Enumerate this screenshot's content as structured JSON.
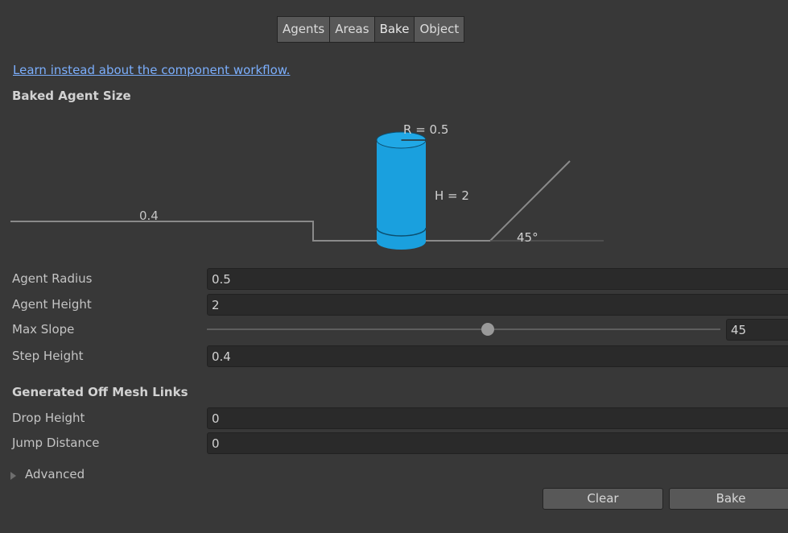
{
  "tabs": [
    "Agents",
    "Areas",
    "Bake",
    "Object"
  ],
  "active_tab": "Bake",
  "link_text": "Learn instead about the component workflow.",
  "section_baked": "Baked Agent Size",
  "diagram": {
    "radius_label": "R = 0.5",
    "height_label": "H = 2",
    "step_label": "0.4",
    "slope_label": "45°",
    "agent_color": "#1aa0de"
  },
  "fields": {
    "agent_radius": {
      "label": "Agent Radius",
      "value": "0.5"
    },
    "agent_height": {
      "label": "Agent Height",
      "value": "2"
    },
    "max_slope": {
      "label": "Max Slope",
      "value": "45",
      "min": 0,
      "max": 60
    },
    "step_height": {
      "label": "Step Height",
      "value": "0.4"
    }
  },
  "section_offmesh": "Generated Off Mesh Links",
  "offmesh": {
    "drop_height": {
      "label": "Drop Height",
      "value": "0"
    },
    "jump_distance": {
      "label": "Jump Distance",
      "value": "0"
    }
  },
  "advanced_label": "Advanced",
  "buttons": {
    "clear": "Clear",
    "bake": "Bake"
  }
}
